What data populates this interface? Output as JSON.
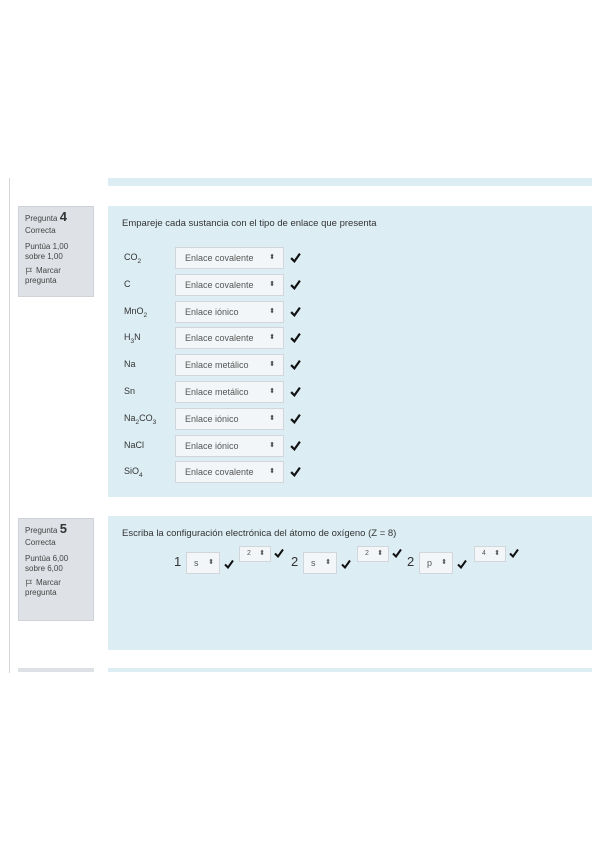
{
  "q4": {
    "label": "Pregunta",
    "number": "4",
    "state": "Correcta",
    "grade_line1": "Puntúa 1,00",
    "grade_line2": "sobre 1,00",
    "flag_line1": "Marcar",
    "flag_line2": "pregunta",
    "text": "Empareje cada sustancia con el tipo de enlace que presenta",
    "rows": [
      {
        "formula": [
          "CO",
          "2",
          ""
        ],
        "answer": "Enlace covalente"
      },
      {
        "formula": [
          "C",
          "",
          ""
        ],
        "answer": "Enlace covalente"
      },
      {
        "formula": [
          "MnO",
          "2",
          ""
        ],
        "answer": "Enlace iónico"
      },
      {
        "formula": [
          "H",
          "3",
          "N"
        ],
        "answer": "Enlace covalente"
      },
      {
        "formula": [
          "Na",
          "",
          ""
        ],
        "answer": "Enlace metálico"
      },
      {
        "formula": [
          "Sn",
          "",
          ""
        ],
        "answer": "Enlace metálico"
      },
      {
        "formula": [
          "Na",
          "2",
          "CO"
        ],
        "formula_tail": [
          "3"
        ],
        "answer": "Enlace iónico"
      },
      {
        "formula": [
          "NaCl",
          "",
          ""
        ],
        "answer": "Enlace iónico"
      },
      {
        "formula": [
          "SiO",
          "4",
          ""
        ],
        "answer": "Enlace covalente"
      }
    ]
  },
  "q5": {
    "label": "Pregunta",
    "number": "5",
    "state": "Correcta",
    "grade_line1": "Puntúa 6,00",
    "grade_line2": "sobre 6,00",
    "flag_line1": "Marcar",
    "flag_line2": "pregunta",
    "text": "Escriba la configuración electrónica del átomo de oxígeno (Z = 8)",
    "config": {
      "n1": "1",
      "o1": "s",
      "e1": "2",
      "n2": "2",
      "o2": "s",
      "e2": "2",
      "n3": "2",
      "o3": "p",
      "e3": "4"
    }
  },
  "icons": {
    "caret": "⬍",
    "check": "check-icon",
    "flag": "flag-icon"
  },
  "colors": {
    "content_bg": "#dcedf4",
    "info_bg": "#dee2e6",
    "check": "#111111"
  }
}
